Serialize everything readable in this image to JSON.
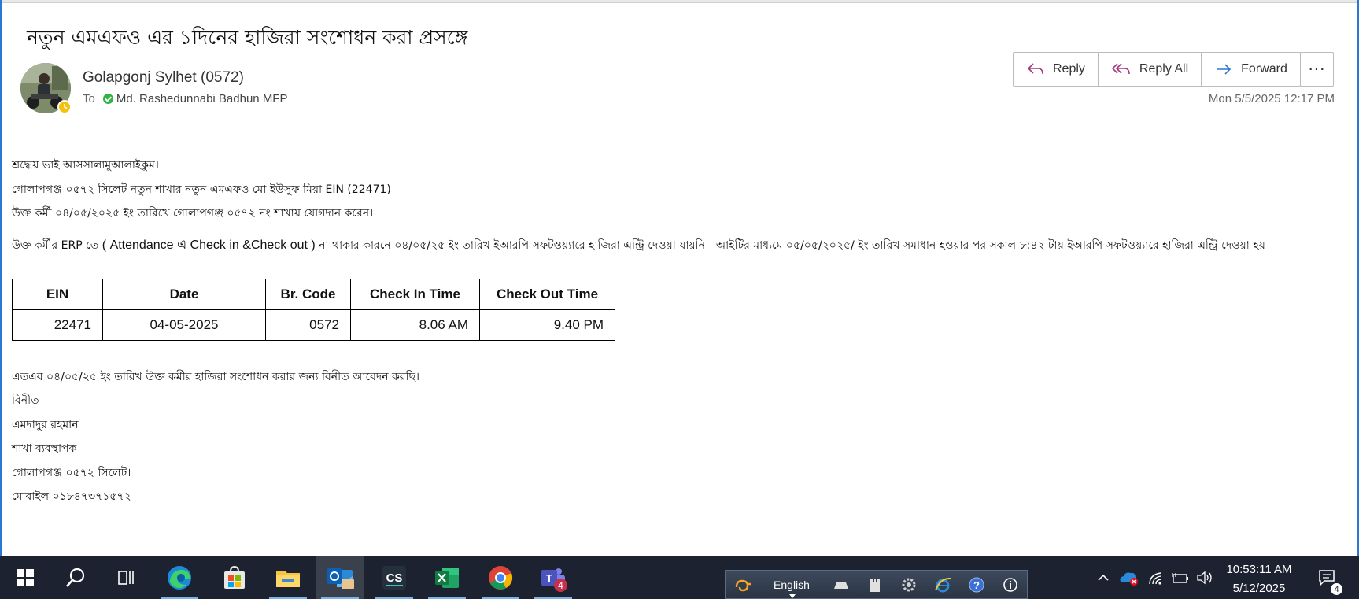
{
  "email": {
    "subject": "নতুন এমএফও এর ১দিনের  হাজিরা সংশোধন করা প্রসঙ্গে",
    "sender": "Golapgonj Sylhet (0572)",
    "to_label": "To",
    "recipient": "Md. Rashedunnabi Badhun MFP",
    "date": "Mon 5/5/2025 12:17 PM"
  },
  "actions": {
    "reply": "Reply",
    "reply_all": "Reply All",
    "forward": "Forward",
    "more": "···"
  },
  "body": {
    "greeting": "শ্রদ্ধেয়  ভাই  আসসালামুআলাইকুম।",
    "line1": "গোলাপগঞ্জ  ০৫৭২  সিলেট  নতুন  শাখার  নতুন  এমএফও  মো ইউসুফ মিয়া EIN (22471)",
    "line2": "উক্ত  কর্মী  ০৪/০৫/২০২৫  ইং  তারিখে  গোলাপগঞ্জ  ০৫৭২  নং  শাখায়  যোগদান  করেন।",
    "para_a": "উক্ত  কর্মীর  ERP  তে",
    "para_b": " ( Attendance এ Check in &Check out ) ",
    "para_c": "না  থাকার  কারনে  ০৪/০৫/২৫  ইং  তারিখ   ইআরপি  সফটওয়্যারে  হাজিরা  এন্ট্রি  দেওয়া  যায়নি  ।  আইটির  মাধ্যমে  ০৫/০৫/২০২৫/  ইং  তারিখ  সমাধান  হওয়ার  পর  সকাল  ৮:৪২  টায়  ইআরপি  সফটওয়্যারে  হাজিরা  এন্ট্রি  দেওয়া  হয়",
    "request": "এতএব  ০৪/০৫/২৫  ইং  তারিখ  উক্ত  কর্মীর  হাজিরা  সংশোধন করার  জন্য  বিনীত  আবেদন  করছি।",
    "closing": "বিনীত",
    "name": "এমদাদুর  রহমান",
    "designation": "শাখা  ব্যবস্থাপক",
    "branch": "গোলাপগঞ্জ  ০৫৭২  সিলেট।",
    "mobile": "মোবাইল  ০১৮৪৭৩৭১৫৭২"
  },
  "table": {
    "headers": [
      "EIN",
      "Date",
      "Br. Code",
      "Check In Time",
      "Check Out Time"
    ],
    "rows": [
      [
        "22471",
        "04-05-2025",
        "0572",
        "8.06 AM",
        "9.40 PM"
      ]
    ]
  },
  "taskbar": {
    "language": "English",
    "time": "10:53:11 AM",
    "date": "5/12/2025",
    "notification_count": "4",
    "teams_badge": "4"
  }
}
